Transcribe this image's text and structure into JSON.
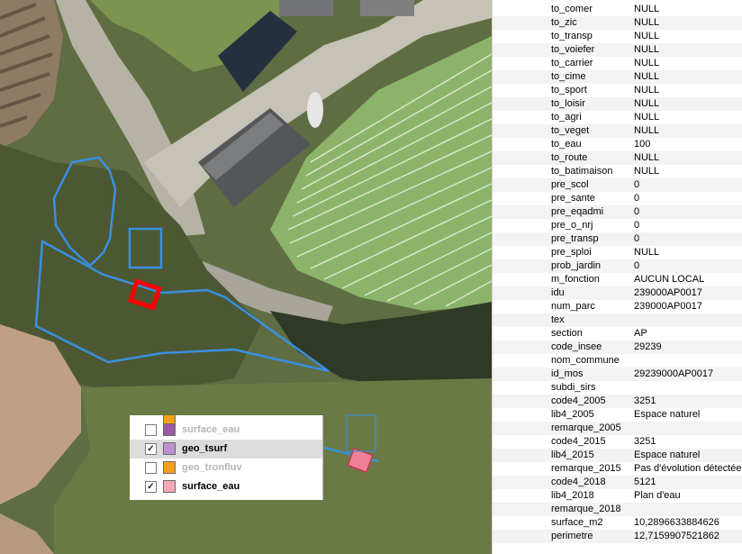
{
  "attributes": [
    {
      "name": "to_comer",
      "value": "NULL"
    },
    {
      "name": "to_zic",
      "value": "NULL"
    },
    {
      "name": "to_transp",
      "value": "NULL"
    },
    {
      "name": "to_voiefer",
      "value": "NULL"
    },
    {
      "name": "to_carrier",
      "value": "NULL"
    },
    {
      "name": "to_cime",
      "value": "NULL"
    },
    {
      "name": "to_sport",
      "value": "NULL"
    },
    {
      "name": "to_loisir",
      "value": "NULL"
    },
    {
      "name": "to_agri",
      "value": "NULL"
    },
    {
      "name": "to_veget",
      "value": "NULL"
    },
    {
      "name": "to_eau",
      "value": "100"
    },
    {
      "name": "to_route",
      "value": "NULL"
    },
    {
      "name": "to_batimaison",
      "value": "NULL"
    },
    {
      "name": "pre_scol",
      "value": "0"
    },
    {
      "name": "pre_sante",
      "value": "0"
    },
    {
      "name": "pre_eqadmi",
      "value": "0"
    },
    {
      "name": "pre_o_nrj",
      "value": "0"
    },
    {
      "name": "pre_transp",
      "value": "0"
    },
    {
      "name": "pre_sploi",
      "value": "NULL"
    },
    {
      "name": "prob_jardin",
      "value": "0"
    },
    {
      "name": "m_fonction",
      "value": "AUCUN LOCAL"
    },
    {
      "name": "idu",
      "value": "239000AP0017"
    },
    {
      "name": "num_parc",
      "value": "239000AP0017"
    },
    {
      "name": "tex",
      "value": ""
    },
    {
      "name": "section",
      "value": "AP"
    },
    {
      "name": "code_insee",
      "value": "29239"
    },
    {
      "name": "nom_commune",
      "value": ""
    },
    {
      "name": "id_mos",
      "value": "29239000AP0017"
    },
    {
      "name": "subdi_sirs",
      "value": ""
    },
    {
      "name": "code4_2005",
      "value": "3251"
    },
    {
      "name": "lib4_2005",
      "value": "Espace naturel"
    },
    {
      "name": "remarque_2005",
      "value": ""
    },
    {
      "name": "code4_2015",
      "value": "3251"
    },
    {
      "name": "lib4_2015",
      "value": "Espace naturel"
    },
    {
      "name": "remarque_2015",
      "value": "Pas d'évolution détectée"
    },
    {
      "name": "code4_2018",
      "value": "5121"
    },
    {
      "name": "lib4_2018",
      "value": "Plan d'eau"
    },
    {
      "name": "remarque_2018",
      "value": ""
    },
    {
      "name": "surface_m2",
      "value": "10,2896633884626"
    },
    {
      "name": "perimetre",
      "value": "12,7159907521862"
    }
  ],
  "layers": [
    {
      "name": "surface_eau",
      "checked": false,
      "color": "#9b59a6",
      "enabled": false
    },
    {
      "name": "geo_tsurf",
      "checked": true,
      "color": "#c08fd0",
      "enabled": true,
      "selected": true
    },
    {
      "name": "geo_tronfluv",
      "checked": false,
      "color": "#f5a01a",
      "enabled": false
    },
    {
      "name": "surface_eau",
      "checked": true,
      "color": "#f4a7b4",
      "enabled": true
    }
  ],
  "colors": {
    "outline_blue": "#3a8fe0",
    "highlight_red": "#ff0000",
    "feature_pink": "#f08098"
  }
}
